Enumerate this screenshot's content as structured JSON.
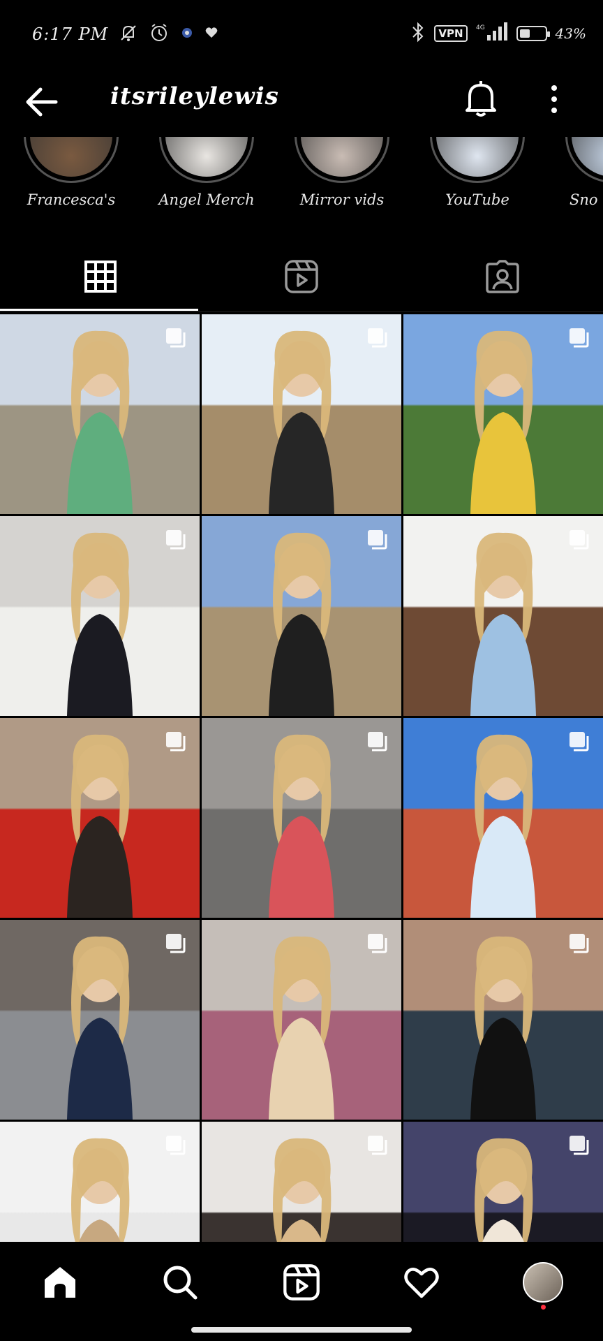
{
  "status_bar": {
    "time": "6:17 PM",
    "vpn_label": "VPN",
    "battery_text": "43%",
    "battery_level": 0.43,
    "icons": [
      "mute-notifications-icon",
      "alarm-icon",
      "vpn-key-icon",
      "heart-icon",
      "bluetooth-icon",
      "signal-icon",
      "battery-icon"
    ]
  },
  "header": {
    "username": "itsrileylewis",
    "icons": [
      "back-arrow-icon",
      "bell-icon",
      "more-vertical-icon"
    ]
  },
  "highlights": [
    {
      "label": "Francesca's",
      "color": "#7a5a40"
    },
    {
      "label": "Angel Merch",
      "color": "#e9e6e2"
    },
    {
      "label": "Mirror vids",
      "color": "#c9bcb4"
    },
    {
      "label": "YouTube",
      "color": "#dfe6f0"
    },
    {
      "label": "Sno",
      "color": "#c6d4e6"
    }
  ],
  "tabs": [
    {
      "name": "posts-grid",
      "icon": "grid-icon",
      "active": true
    },
    {
      "name": "reels",
      "icon": "reels-icon",
      "active": false
    },
    {
      "name": "tagged",
      "icon": "tagged-icon",
      "active": false
    }
  ],
  "grid_posts": [
    {
      "theme": "festival-green-outfit",
      "sky": "#cfd8e4",
      "ground": "#9d9583",
      "accent": "#5fae7e"
    },
    {
      "theme": "festival-ferris-wheel",
      "sky": "#e6eef6",
      "ground": "#a58d6a",
      "accent": "#262626"
    },
    {
      "theme": "festival-yellow-top",
      "sky": "#7aa6e0",
      "ground": "#4c7a37",
      "accent": "#e8c43b"
    },
    {
      "theme": "white-cardigan",
      "sky": "#d5d3d0",
      "ground": "#efefec",
      "accent": "#1b1b22"
    },
    {
      "theme": "field-black-coat",
      "sky": "#86a7d6",
      "ground": "#a89372",
      "accent": "#1f1f1f"
    },
    {
      "theme": "blue-dress-door",
      "sky": "#f2f2f0",
      "ground": "#6e4a34",
      "accent": "#9ec1e2"
    },
    {
      "theme": "black-jacket-red-wall",
      "sky": "#b09a86",
      "ground": "#c7281f",
      "accent": "#2b2420"
    },
    {
      "theme": "mirror-selfie-gray",
      "sky": "#9a9794",
      "ground": "#6f6e6c",
      "accent": "#d9545a"
    },
    {
      "theme": "beach-towel",
      "sky": "#3f7ed6",
      "ground": "#c8573c",
      "accent": "#d9e9f7"
    },
    {
      "theme": "stone-castle-jacket",
      "sky": "#6f6863",
      "ground": "#8b8d91",
      "accent": "#1d2a47"
    },
    {
      "theme": "portrait-mauve-top",
      "sky": "#c5beb8",
      "ground": "#a7627a",
      "accent": "#e8d2b0"
    },
    {
      "theme": "black-dress-indoor",
      "sky": "#b18e78",
      "ground": "#2f3d4a",
      "accent": "#111111"
    },
    {
      "theme": "braid-portrait",
      "sky": "#f2f2f2",
      "ground": "#e8e8e8",
      "accent": "#c7a880"
    },
    {
      "theme": "leather-jacket",
      "sky": "#e8e5e2",
      "ground": "#3a3330",
      "accent": "#d9b88a"
    },
    {
      "theme": "city-lights-corset",
      "sky": "#44446a",
      "ground": "#1b1a24",
      "accent": "#f0e6d8"
    }
  ],
  "bottom_nav": [
    {
      "name": "home",
      "icon": "home-icon"
    },
    {
      "name": "search",
      "icon": "search-icon"
    },
    {
      "name": "reels",
      "icon": "reels-icon"
    },
    {
      "name": "activity",
      "icon": "heart-icon"
    },
    {
      "name": "profile",
      "icon": "profile-avatar-icon"
    }
  ]
}
